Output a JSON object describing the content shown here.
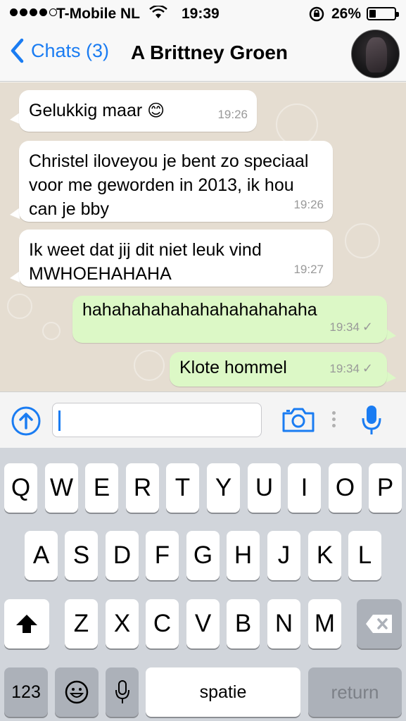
{
  "status": {
    "carrier": "T-Mobile NL",
    "time": "19:39",
    "battery_percent": "26%",
    "battery_level": 0.26
  },
  "nav": {
    "back_label": "Chats (3)",
    "contact_name": "A Brittney Groen"
  },
  "messages": [
    {
      "direction": "in",
      "text": "Gelukkig maar",
      "emoji": "😊",
      "time": "19:26"
    },
    {
      "direction": "in",
      "text": "Christel iloveyou je bent zo speciaal voor me geworden in 2013, ik hou can je bby",
      "time": "19:26"
    },
    {
      "direction": "in",
      "text": "Ik weet dat jij dit niet leuk vind MWHOEHAHAHA",
      "time": "19:27"
    },
    {
      "direction": "out",
      "text": "hahahahahahahahahahahaha",
      "time": "19:34",
      "status": "✓"
    },
    {
      "direction": "out",
      "text": "Klote hommel",
      "time": "19:34",
      "status": "✓"
    }
  ],
  "input": {
    "value": "",
    "icons": [
      "upload-icon",
      "camera-icon",
      "microphone-icon"
    ]
  },
  "keyboard": {
    "row1": [
      "Q",
      "W",
      "E",
      "R",
      "T",
      "Y",
      "U",
      "I",
      "O",
      "P"
    ],
    "row2": [
      "A",
      "S",
      "D",
      "F",
      "G",
      "H",
      "J",
      "K",
      "L"
    ],
    "row3": [
      "Z",
      "X",
      "C",
      "V",
      "B",
      "N",
      "M"
    ],
    "numbers_label": "123",
    "space_label": "spatie",
    "return_label": "return"
  },
  "colors": {
    "accent": "#1a7cf2",
    "bubble_in": "#ffffff",
    "bubble_out": "#dcf8c6",
    "chat_bg": "#e5ddd1",
    "keyboard_bg": "#d1d5db"
  }
}
